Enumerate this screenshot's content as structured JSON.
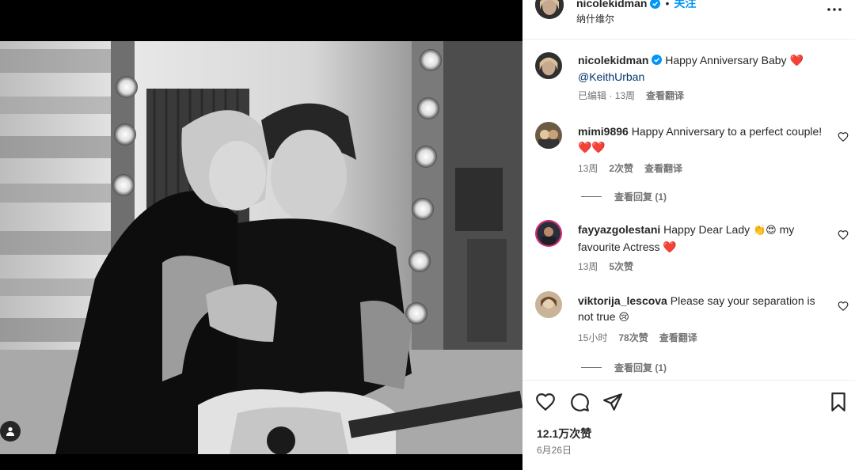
{
  "header": {
    "username": "nicolekidman",
    "follow_label": "关注",
    "location": "纳什维尔"
  },
  "caption": {
    "username": "nicolekidman",
    "text": "Happy Anniversary Baby",
    "emoji": "❤️",
    "mention": "@KeithUrban",
    "edited": "已编辑",
    "age": "13周",
    "translate": "查看翻译"
  },
  "comments": [
    {
      "username": "mimi9896",
      "text": "Happy Anniversary to a perfect couple!",
      "emoji": "❤️❤️",
      "age": "13周",
      "likes": "2次赞",
      "translate": "查看翻译",
      "replies": "查看回复 (1)"
    },
    {
      "username": "fayyazgolestani",
      "text": "Happy Dear Lady",
      "emoji_mid": "👏😍",
      "text2": "my favourite Actress",
      "emoji": "❤️",
      "age": "13周",
      "likes": "5次赞"
    },
    {
      "username": "viktorija_lescova",
      "text": "Please say your separation is not true",
      "emoji": "😢",
      "age": "15小时",
      "likes": "78次赞",
      "translate": "查看翻译",
      "replies": "查看回复 (1)"
    }
  ],
  "actions": {
    "like_icon": "heart-icon",
    "comment_icon": "comment-icon",
    "share_icon": "share-icon",
    "save_icon": "bookmark-icon"
  },
  "likes_count": "12.1万次赞",
  "post_date": "6月26日",
  "colors": {
    "link_blue": "#0095f6",
    "mention_blue": "#00376b",
    "verified_blue": "#0095f6",
    "muted": "#737373",
    "heart_red": "#e0245e"
  }
}
